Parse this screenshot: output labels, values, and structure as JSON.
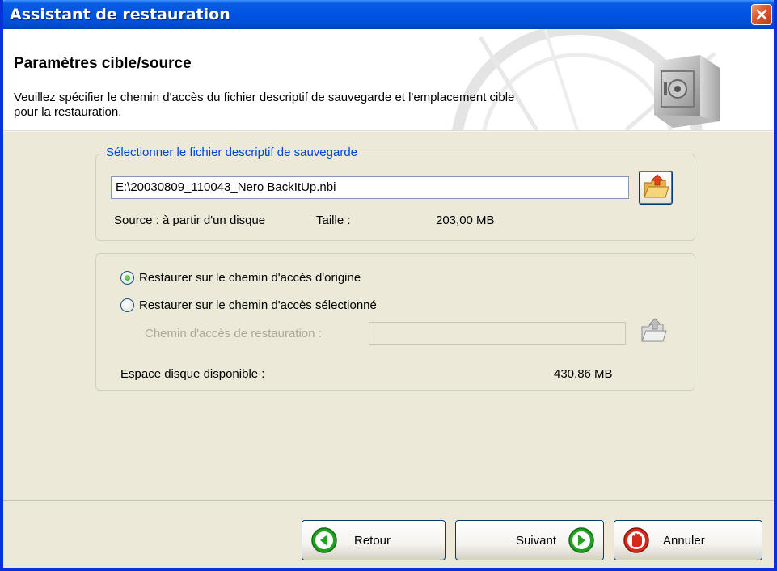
{
  "window": {
    "title": "Assistant de restauration",
    "close_icon": "close-icon"
  },
  "header": {
    "title": "Paramètres cible/source",
    "description": "Veuillez spécifier le chemin d'accès du fichier descriptif de sauvegarde et l'emplacement cible pour la restauration.",
    "icon": "safe-icon"
  },
  "source_group": {
    "legend": "Sélectionner le fichier descriptif de sauvegarde",
    "file_path": "E:\\20030809_110043_Nero BackItUp.nbi",
    "browse_icon": "open-folder-icon",
    "source_label": "Source : à partir d'un disque",
    "size_label": "Taille :",
    "size_value": "203,00 MB"
  },
  "target_group": {
    "option_original": "Restaurer sur le chemin d'accès d'origine",
    "option_selected": "Restaurer sur le chemin d'accès sélectionné",
    "selected_option": "original",
    "path_label": "Chemin d'accès de restauration :",
    "path_value": "",
    "browse_icon": "open-folder-icon",
    "space_label": "Espace disque disponible :",
    "space_value": "430,86 MB"
  },
  "buttons": {
    "back": "Retour",
    "next": "Suivant",
    "cancel": "Annuler"
  },
  "colors": {
    "titlebar": "#0054e3",
    "dialog_bg": "#ece9d8",
    "legend_text": "#0046d5",
    "nav_green": "#21a121",
    "cancel_red": "#d8281a"
  }
}
